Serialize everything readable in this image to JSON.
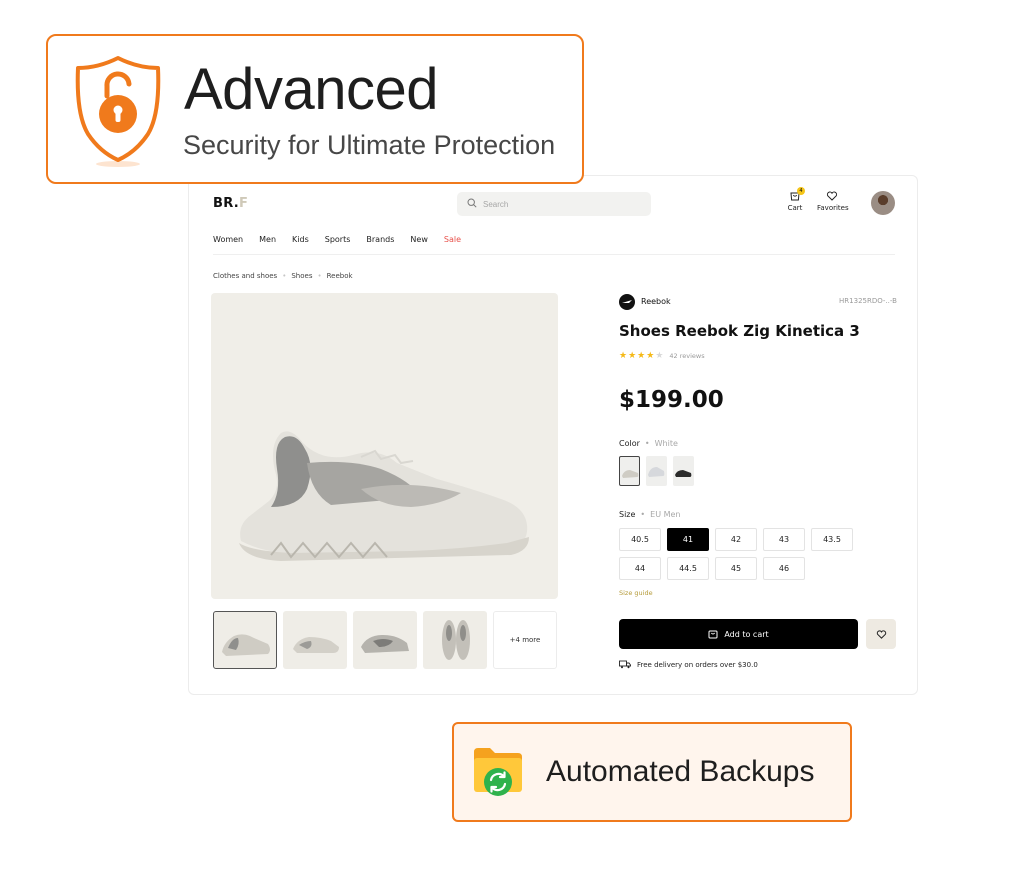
{
  "store": {
    "logo_main": "BR.",
    "logo_accent": "F",
    "search_placeholder": "Search",
    "cart_label": "Cart",
    "cart_count": "4",
    "favorites_label": "Favorites",
    "nav": [
      "Women",
      "Men",
      "Kids",
      "Sports",
      "Brands",
      "New",
      "Sale"
    ],
    "breadcrumb": [
      "Clothes and shoes",
      "Shoes",
      "Reebok"
    ],
    "thumbs_more": "+4 more"
  },
  "product": {
    "brand": "Reebok",
    "sku": "HR1325RDO-..-B",
    "title": "Shoes Reebok Zig Kinetica 3",
    "rating": 4,
    "rating_max": 5,
    "reviews": "42 reviews",
    "price": "$199.00",
    "color_label": "Color",
    "color_value": "White",
    "size_label": "Size",
    "size_system": "EU Men",
    "sizes": [
      "40.5",
      "41",
      "42",
      "43",
      "43.5",
      "44",
      "44.5",
      "45",
      "46"
    ],
    "selected_size": "41",
    "size_guide": "Size guide",
    "add_to_cart": "Add to cart",
    "delivery": "Free delivery on orders over $30.0"
  },
  "callouts": {
    "security_title": "Advanced",
    "security_subtitle": "Security for Ultimate Protection",
    "backup_title": "Automated Backups"
  },
  "colors": {
    "accent_orange": "#f07a1c",
    "sale_red": "#e8504a",
    "star_yellow": "#f5b917",
    "cta_black": "#000000"
  },
  "icons": [
    "shield-lock-icon",
    "folder-sync-icon",
    "search-icon",
    "cart-icon",
    "heart-icon",
    "reebok-logo-icon",
    "truck-icon",
    "star-icon"
  ]
}
